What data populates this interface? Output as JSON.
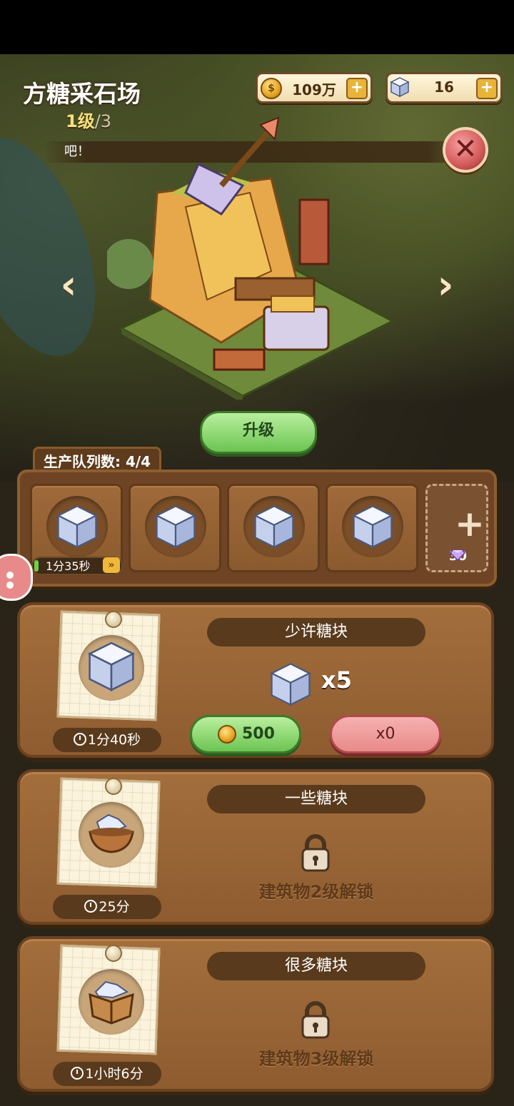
{
  "header": {
    "title": "方糖采石场",
    "level_current": "1级",
    "level_max": "/3",
    "ticker_text": "吧！"
  },
  "resources": {
    "coins": "109万",
    "sugar_cubes": "16"
  },
  "buttons": {
    "upgrade": "升级",
    "close": "✕",
    "prev": "‹",
    "next": "›"
  },
  "queue": {
    "label": "生产队列数: 4/4",
    "slots": [
      {
        "item": "sugar-cube",
        "timer": "1分35秒",
        "progress": 0.05
      },
      {
        "item": "sugar-cube"
      },
      {
        "item": "sugar-cube"
      },
      {
        "item": "sugar-cube"
      }
    ],
    "add_slot_cost": "30",
    "speedup_label": "»"
  },
  "recipes": [
    {
      "name": "少许糖块",
      "time": "1分40秒",
      "yield": "x5",
      "price": "500",
      "alt": "x0",
      "locked": false
    },
    {
      "name": "一些糖块",
      "time": "25分",
      "locked": true,
      "unlock_text": "建筑物2级解锁"
    },
    {
      "name": "很多糖块",
      "time": "1小时6分",
      "locked": true,
      "unlock_text": "建筑物3级解锁"
    }
  ],
  "colors": {
    "wood": "#8e5c30",
    "green_button": "#6cc452",
    "red_button": "#e88a8a"
  }
}
